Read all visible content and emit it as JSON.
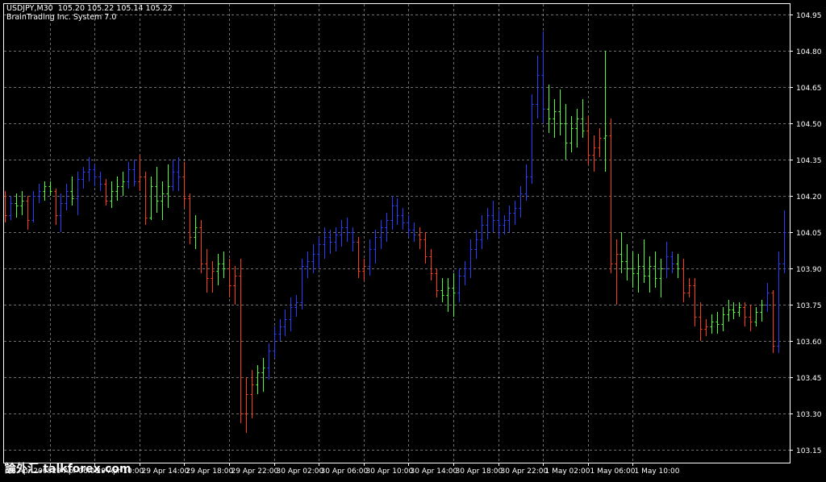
{
  "header": {
    "symbol_line": "USDJPY,M30  105.20 105.22 105.14 105.22",
    "indicator_line": "BrainTrading Inc. System 7.0"
  },
  "colors": {
    "background": "#000000",
    "grid": "#c8c8c8",
    "axis": "#ffffff",
    "up": "#2a3cff",
    "down": "#ff3c14",
    "neutral": "#50ff32"
  },
  "watermark": "論外汇.talkforex.com",
  "chart_data": {
    "type": "ohlc",
    "symbol": "USDJPY",
    "timeframe": "M30",
    "ylim": [
      103.1,
      105.0
    ],
    "y_ticks": [
      104.95,
      104.8,
      104.65,
      104.5,
      104.35,
      104.2,
      104.05,
      103.9,
      103.75,
      103.6,
      103.45,
      103.3,
      103.15
    ],
    "x_tick_labels": [
      "28 Apr 2008",
      "29 Apr 06:00",
      "29 Apr 10:00",
      "29 Apr 14:00",
      "29 Apr 18:00",
      "29 Apr 22:00",
      "30 Apr 02:00",
      "30 Apr 06:00",
      "30 Apr 10:00",
      "30 Apr 14:00",
      "30 Apr 18:00",
      "30 Apr 22:00",
      "1 May 02:00",
      "1 May 06:00",
      "1 May 10:00"
    ],
    "grid": true,
    "bars": [
      {
        "o": 104.2,
        "h": 104.22,
        "l": 104.09,
        "c": 104.12,
        "s": "down"
      },
      {
        "o": 104.12,
        "h": 104.2,
        "l": 104.1,
        "c": 104.17,
        "s": "up"
      },
      {
        "o": 104.17,
        "h": 104.21,
        "l": 104.11,
        "c": 104.16,
        "s": "neutral"
      },
      {
        "o": 104.16,
        "h": 104.22,
        "l": 104.12,
        "c": 104.18,
        "s": "neutral"
      },
      {
        "o": 104.18,
        "h": 104.2,
        "l": 104.06,
        "c": 104.1,
        "s": "down"
      },
      {
        "o": 104.1,
        "h": 104.22,
        "l": 104.09,
        "c": 104.2,
        "s": "up"
      },
      {
        "o": 104.2,
        "h": 104.25,
        "l": 104.17,
        "c": 104.22,
        "s": "up"
      },
      {
        "o": 104.22,
        "h": 104.26,
        "l": 104.18,
        "c": 104.24,
        "s": "neutral"
      },
      {
        "o": 104.24,
        "h": 104.26,
        "l": 104.2,
        "c": 104.22,
        "s": "neutral"
      },
      {
        "o": 104.22,
        "h": 104.23,
        "l": 104.08,
        "c": 104.12,
        "s": "down"
      },
      {
        "o": 104.12,
        "h": 104.21,
        "l": 104.05,
        "c": 104.17,
        "s": "up"
      },
      {
        "o": 104.17,
        "h": 104.25,
        "l": 104.14,
        "c": 104.22,
        "s": "up"
      },
      {
        "o": 104.22,
        "h": 104.28,
        "l": 104.16,
        "c": 104.19,
        "s": "neutral"
      },
      {
        "o": 104.19,
        "h": 104.3,
        "l": 104.12,
        "c": 104.27,
        "s": "up"
      },
      {
        "o": 104.27,
        "h": 104.32,
        "l": 104.23,
        "c": 104.3,
        "s": "up"
      },
      {
        "o": 104.3,
        "h": 104.36,
        "l": 104.26,
        "c": 104.31,
        "s": "up"
      },
      {
        "o": 104.31,
        "h": 104.33,
        "l": 104.24,
        "c": 104.28,
        "s": "up"
      },
      {
        "o": 104.28,
        "h": 104.3,
        "l": 104.22,
        "c": 104.25,
        "s": "up"
      },
      {
        "o": 104.25,
        "h": 104.27,
        "l": 104.16,
        "c": 104.18,
        "s": "down"
      },
      {
        "o": 104.18,
        "h": 104.26,
        "l": 104.15,
        "c": 104.22,
        "s": "neutral"
      },
      {
        "o": 104.22,
        "h": 104.28,
        "l": 104.18,
        "c": 104.24,
        "s": "neutral"
      },
      {
        "o": 104.24,
        "h": 104.3,
        "l": 104.2,
        "c": 104.26,
        "s": "neutral"
      },
      {
        "o": 104.26,
        "h": 104.34,
        "l": 104.23,
        "c": 104.31,
        "s": "up"
      },
      {
        "o": 104.31,
        "h": 104.35,
        "l": 104.24,
        "c": 104.26,
        "s": "up"
      },
      {
        "o": 104.26,
        "h": 104.37,
        "l": 104.22,
        "c": 104.28,
        "s": "down"
      },
      {
        "o": 104.28,
        "h": 104.3,
        "l": 104.08,
        "c": 104.11,
        "s": "down"
      },
      {
        "o": 104.11,
        "h": 104.28,
        "l": 104.1,
        "c": 104.24,
        "s": "neutral"
      },
      {
        "o": 104.24,
        "h": 104.32,
        "l": 104.13,
        "c": 104.18,
        "s": "neutral"
      },
      {
        "o": 104.18,
        "h": 104.26,
        "l": 104.1,
        "c": 104.21,
        "s": "neutral"
      },
      {
        "o": 104.21,
        "h": 104.33,
        "l": 104.15,
        "c": 104.24,
        "s": "neutral"
      },
      {
        "o": 104.24,
        "h": 104.35,
        "l": 104.22,
        "c": 104.3,
        "s": "up"
      },
      {
        "o": 104.3,
        "h": 104.36,
        "l": 104.22,
        "c": 104.28,
        "s": "up"
      },
      {
        "o": 104.28,
        "h": 104.34,
        "l": 104.15,
        "c": 104.19,
        "s": "down"
      },
      {
        "o": 104.19,
        "h": 104.21,
        "l": 104.0,
        "c": 104.03,
        "s": "down"
      },
      {
        "o": 104.03,
        "h": 104.12,
        "l": 103.98,
        "c": 104.07,
        "s": "neutral"
      },
      {
        "o": 104.07,
        "h": 104.1,
        "l": 103.88,
        "c": 103.92,
        "s": "down"
      },
      {
        "o": 103.92,
        "h": 103.98,
        "l": 103.8,
        "c": 103.86,
        "s": "down"
      },
      {
        "o": 103.86,
        "h": 103.93,
        "l": 103.8,
        "c": 103.89,
        "s": "down"
      },
      {
        "o": 103.89,
        "h": 103.96,
        "l": 103.83,
        "c": 103.92,
        "s": "neutral"
      },
      {
        "o": 103.92,
        "h": 103.97,
        "l": 103.86,
        "c": 103.9,
        "s": "neutral"
      },
      {
        "o": 103.9,
        "h": 103.94,
        "l": 103.78,
        "c": 103.83,
        "s": "down"
      },
      {
        "o": 103.83,
        "h": 103.91,
        "l": 103.75,
        "c": 103.87,
        "s": "down"
      },
      {
        "o": 103.87,
        "h": 103.94,
        "l": 103.26,
        "c": 103.3,
        "s": "down"
      },
      {
        "o": 103.3,
        "h": 103.45,
        "l": 103.22,
        "c": 103.38,
        "s": "down"
      },
      {
        "o": 103.38,
        "h": 103.48,
        "l": 103.28,
        "c": 103.42,
        "s": "down"
      },
      {
        "o": 103.42,
        "h": 103.5,
        "l": 103.38,
        "c": 103.47,
        "s": "neutral"
      },
      {
        "o": 103.47,
        "h": 103.53,
        "l": 103.39,
        "c": 103.49,
        "s": "neutral"
      },
      {
        "o": 103.49,
        "h": 103.59,
        "l": 103.44,
        "c": 103.56,
        "s": "up"
      },
      {
        "o": 103.56,
        "h": 103.66,
        "l": 103.53,
        "c": 103.63,
        "s": "up"
      },
      {
        "o": 103.63,
        "h": 103.69,
        "l": 103.6,
        "c": 103.66,
        "s": "up"
      },
      {
        "o": 103.66,
        "h": 103.73,
        "l": 103.62,
        "c": 103.69,
        "s": "up"
      },
      {
        "o": 103.69,
        "h": 103.78,
        "l": 103.64,
        "c": 103.74,
        "s": "up"
      },
      {
        "o": 103.74,
        "h": 103.79,
        "l": 103.7,
        "c": 103.76,
        "s": "up"
      },
      {
        "o": 103.76,
        "h": 103.94,
        "l": 103.73,
        "c": 103.91,
        "s": "up"
      },
      {
        "o": 103.91,
        "h": 103.97,
        "l": 103.86,
        "c": 103.93,
        "s": "up"
      },
      {
        "o": 103.93,
        "h": 104.0,
        "l": 103.88,
        "c": 103.96,
        "s": "up"
      },
      {
        "o": 103.96,
        "h": 104.03,
        "l": 103.9,
        "c": 104.0,
        "s": "up"
      },
      {
        "o": 104.0,
        "h": 104.07,
        "l": 103.94,
        "c": 104.03,
        "s": "up"
      },
      {
        "o": 104.03,
        "h": 104.06,
        "l": 103.96,
        "c": 104.01,
        "s": "up"
      },
      {
        "o": 104.01,
        "h": 104.07,
        "l": 103.97,
        "c": 104.04,
        "s": "up"
      },
      {
        "o": 104.04,
        "h": 104.1,
        "l": 103.99,
        "c": 104.07,
        "s": "up"
      },
      {
        "o": 104.07,
        "h": 104.11,
        "l": 104.01,
        "c": 104.05,
        "s": "up"
      },
      {
        "o": 104.05,
        "h": 104.07,
        "l": 103.97,
        "c": 104.01,
        "s": "up"
      },
      {
        "o": 104.01,
        "h": 104.03,
        "l": 103.86,
        "c": 103.89,
        "s": "down"
      },
      {
        "o": 103.89,
        "h": 103.94,
        "l": 103.85,
        "c": 103.91,
        "s": "down"
      },
      {
        "o": 103.91,
        "h": 104.02,
        "l": 103.87,
        "c": 103.98,
        "s": "up"
      },
      {
        "o": 103.98,
        "h": 104.06,
        "l": 103.92,
        "c": 104.03,
        "s": "up"
      },
      {
        "o": 104.03,
        "h": 104.1,
        "l": 103.98,
        "c": 104.07,
        "s": "up"
      },
      {
        "o": 104.07,
        "h": 104.13,
        "l": 104.01,
        "c": 104.1,
        "s": "up"
      },
      {
        "o": 104.1,
        "h": 104.2,
        "l": 104.06,
        "c": 104.16,
        "s": "up"
      },
      {
        "o": 104.16,
        "h": 104.19,
        "l": 104.08,
        "c": 104.12,
        "s": "up"
      },
      {
        "o": 104.12,
        "h": 104.15,
        "l": 104.06,
        "c": 104.09,
        "s": "up"
      },
      {
        "o": 104.09,
        "h": 104.12,
        "l": 104.03,
        "c": 104.06,
        "s": "up"
      },
      {
        "o": 104.06,
        "h": 104.09,
        "l": 104.01,
        "c": 104.04,
        "s": "up"
      },
      {
        "o": 104.04,
        "h": 104.07,
        "l": 103.98,
        "c": 104.02,
        "s": "down"
      },
      {
        "o": 104.02,
        "h": 104.05,
        "l": 103.92,
        "c": 103.95,
        "s": "down"
      },
      {
        "o": 103.95,
        "h": 103.98,
        "l": 103.85,
        "c": 103.88,
        "s": "down"
      },
      {
        "o": 103.88,
        "h": 103.9,
        "l": 103.78,
        "c": 103.81,
        "s": "down"
      },
      {
        "o": 103.81,
        "h": 103.86,
        "l": 103.76,
        "c": 103.79,
        "s": "neutral"
      },
      {
        "o": 103.79,
        "h": 103.86,
        "l": 103.72,
        "c": 103.82,
        "s": "neutral"
      },
      {
        "o": 103.82,
        "h": 103.88,
        "l": 103.7,
        "c": 103.8,
        "s": "neutral"
      },
      {
        "o": 103.8,
        "h": 103.9,
        "l": 103.76,
        "c": 103.87,
        "s": "up"
      },
      {
        "o": 103.87,
        "h": 103.93,
        "l": 103.83,
        "c": 103.9,
        "s": "up"
      },
      {
        "o": 103.9,
        "h": 104.02,
        "l": 103.86,
        "c": 103.98,
        "s": "up"
      },
      {
        "o": 103.98,
        "h": 104.06,
        "l": 103.94,
        "c": 104.02,
        "s": "up"
      },
      {
        "o": 104.02,
        "h": 104.12,
        "l": 103.98,
        "c": 104.08,
        "s": "up"
      },
      {
        "o": 104.08,
        "h": 104.15,
        "l": 104.02,
        "c": 104.12,
        "s": "up"
      },
      {
        "o": 104.12,
        "h": 104.18,
        "l": 104.05,
        "c": 104.1,
        "s": "up"
      },
      {
        "o": 104.1,
        "h": 104.14,
        "l": 104.03,
        "c": 104.08,
        "s": "up"
      },
      {
        "o": 104.08,
        "h": 104.12,
        "l": 104.04,
        "c": 104.1,
        "s": "up"
      },
      {
        "o": 104.1,
        "h": 104.16,
        "l": 104.05,
        "c": 104.13,
        "s": "up"
      },
      {
        "o": 104.13,
        "h": 104.18,
        "l": 104.08,
        "c": 104.15,
        "s": "up"
      },
      {
        "o": 104.15,
        "h": 104.24,
        "l": 104.11,
        "c": 104.21,
        "s": "up"
      },
      {
        "o": 104.21,
        "h": 104.33,
        "l": 104.18,
        "c": 104.28,
        "s": "up"
      },
      {
        "o": 104.28,
        "h": 104.62,
        "l": 104.25,
        "c": 104.58,
        "s": "up"
      },
      {
        "o": 104.58,
        "h": 104.78,
        "l": 104.52,
        "c": 104.7,
        "s": "up"
      },
      {
        "o": 104.7,
        "h": 104.88,
        "l": 104.5,
        "c": 104.56,
        "s": "up"
      },
      {
        "o": 104.56,
        "h": 104.66,
        "l": 104.46,
        "c": 104.52,
        "s": "neutral"
      },
      {
        "o": 104.52,
        "h": 104.6,
        "l": 104.44,
        "c": 104.55,
        "s": "neutral"
      },
      {
        "o": 104.55,
        "h": 104.64,
        "l": 104.45,
        "c": 104.5,
        "s": "neutral"
      },
      {
        "o": 104.5,
        "h": 104.58,
        "l": 104.35,
        "c": 104.42,
        "s": "neutral"
      },
      {
        "o": 104.42,
        "h": 104.53,
        "l": 104.38,
        "c": 104.48,
        "s": "neutral"
      },
      {
        "o": 104.48,
        "h": 104.56,
        "l": 104.4,
        "c": 104.52,
        "s": "neutral"
      },
      {
        "o": 104.52,
        "h": 104.6,
        "l": 104.44,
        "c": 104.47,
        "s": "neutral"
      },
      {
        "o": 104.47,
        "h": 104.53,
        "l": 104.33,
        "c": 104.37,
        "s": "down"
      },
      {
        "o": 104.37,
        "h": 104.45,
        "l": 104.3,
        "c": 104.4,
        "s": "down"
      },
      {
        "o": 104.4,
        "h": 104.48,
        "l": 104.36,
        "c": 104.44,
        "s": "down"
      },
      {
        "o": 104.44,
        "h": 104.8,
        "l": 104.3,
        "c": 104.45,
        "s": "neutral"
      },
      {
        "o": 104.45,
        "h": 104.52,
        "l": 103.88,
        "c": 103.92,
        "s": "down"
      },
      {
        "o": 103.92,
        "h": 104.02,
        "l": 103.75,
        "c": 103.96,
        "s": "down"
      },
      {
        "o": 103.96,
        "h": 104.05,
        "l": 103.88,
        "c": 103.93,
        "s": "neutral"
      },
      {
        "o": 103.93,
        "h": 104.0,
        "l": 103.85,
        "c": 103.9,
        "s": "neutral"
      },
      {
        "o": 103.9,
        "h": 103.97,
        "l": 103.82,
        "c": 103.88,
        "s": "neutral"
      },
      {
        "o": 103.88,
        "h": 103.96,
        "l": 103.8,
        "c": 103.91,
        "s": "neutral"
      },
      {
        "o": 103.91,
        "h": 104.02,
        "l": 103.84,
        "c": 103.87,
        "s": "neutral"
      },
      {
        "o": 103.87,
        "h": 103.95,
        "l": 103.8,
        "c": 103.91,
        "s": "neutral"
      },
      {
        "o": 103.91,
        "h": 103.97,
        "l": 103.82,
        "c": 103.86,
        "s": "neutral"
      },
      {
        "o": 103.86,
        "h": 103.94,
        "l": 103.78,
        "c": 103.9,
        "s": "neutral"
      },
      {
        "o": 103.9,
        "h": 104.01,
        "l": 103.86,
        "c": 103.95,
        "s": "up"
      },
      {
        "o": 103.95,
        "h": 103.97,
        "l": 103.88,
        "c": 103.92,
        "s": "up"
      },
      {
        "o": 103.92,
        "h": 103.96,
        "l": 103.86,
        "c": 103.9,
        "s": "neutral"
      },
      {
        "o": 103.9,
        "h": 103.94,
        "l": 103.76,
        "c": 103.8,
        "s": "down"
      },
      {
        "o": 103.8,
        "h": 103.86,
        "l": 103.78,
        "c": 103.83,
        "s": "down"
      },
      {
        "o": 103.83,
        "h": 103.86,
        "l": 103.66,
        "c": 103.7,
        "s": "down"
      },
      {
        "o": 103.7,
        "h": 103.76,
        "l": 103.6,
        "c": 103.65,
        "s": "down"
      },
      {
        "o": 103.65,
        "h": 103.69,
        "l": 103.62,
        "c": 103.66,
        "s": "down"
      },
      {
        "o": 103.66,
        "h": 103.71,
        "l": 103.63,
        "c": 103.68,
        "s": "neutral"
      },
      {
        "o": 103.68,
        "h": 103.72,
        "l": 103.63,
        "c": 103.67,
        "s": "neutral"
      },
      {
        "o": 103.67,
        "h": 103.74,
        "l": 103.64,
        "c": 103.71,
        "s": "neutral"
      },
      {
        "o": 103.71,
        "h": 103.77,
        "l": 103.68,
        "c": 103.73,
        "s": "neutral"
      },
      {
        "o": 103.73,
        "h": 103.76,
        "l": 103.69,
        "c": 103.72,
        "s": "neutral"
      },
      {
        "o": 103.72,
        "h": 103.76,
        "l": 103.7,
        "c": 103.74,
        "s": "neutral"
      },
      {
        "o": 103.74,
        "h": 103.76,
        "l": 103.66,
        "c": 103.7,
        "s": "down"
      },
      {
        "o": 103.7,
        "h": 103.75,
        "l": 103.64,
        "c": 103.68,
        "s": "down"
      },
      {
        "o": 103.68,
        "h": 103.74,
        "l": 103.66,
        "c": 103.72,
        "s": "neutral"
      },
      {
        "o": 103.72,
        "h": 103.77,
        "l": 103.68,
        "c": 103.75,
        "s": "neutral"
      },
      {
        "o": 103.75,
        "h": 103.84,
        "l": 103.72,
        "c": 103.8,
        "s": "up"
      },
      {
        "o": 103.8,
        "h": 103.81,
        "l": 103.55,
        "c": 103.58,
        "s": "down"
      },
      {
        "o": 103.58,
        "h": 103.97,
        "l": 103.55,
        "c": 103.92,
        "s": "up"
      },
      {
        "o": 103.92,
        "h": 104.14,
        "l": 103.88,
        "c": 104.05,
        "s": "up"
      }
    ]
  }
}
